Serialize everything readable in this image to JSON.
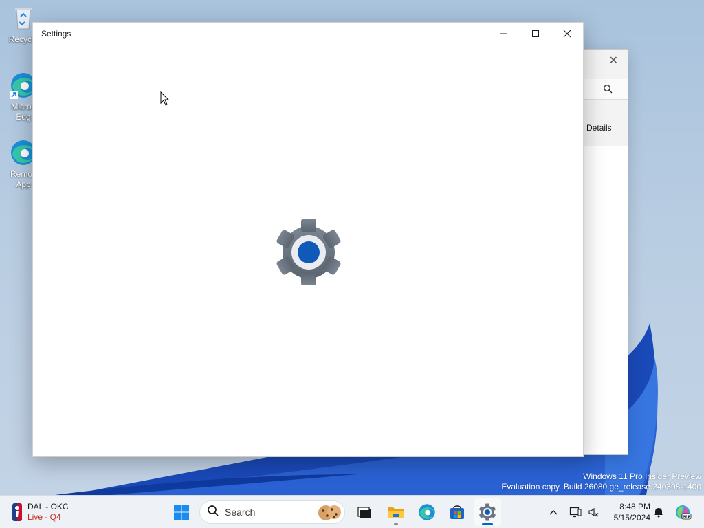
{
  "desktop": {
    "icons": [
      {
        "label": "Recycle",
        "icon": "recycle-bin-icon"
      },
      {
        "label": "Micros\nEdg",
        "icon": "edge-icon"
      },
      {
        "label": "Remov\nApp",
        "icon": "edge-icon"
      }
    ],
    "watermark": {
      "line1": "Windows 11 Pro Insider Preview",
      "line2": "Evaluation copy. Build 26080.ge_release.240308-1400"
    }
  },
  "background_window": {
    "details_label": "Details",
    "icons": [
      "close-icon",
      "search-icon"
    ]
  },
  "settings_window": {
    "title": "Settings",
    "controls": [
      "minimize-icon",
      "maximize-icon",
      "close-icon"
    ],
    "splash_icon": "gear-icon"
  },
  "taskbar": {
    "widget": {
      "line1": "DAL - OKC",
      "line2": "Live - Q4",
      "icon": "nba-logo-icon"
    },
    "search_placeholder": "Search",
    "apps": [
      {
        "name": "start",
        "icon": "windows-logo-icon"
      },
      {
        "name": "task-view",
        "icon": "task-view-icon"
      },
      {
        "name": "file-explorer",
        "icon": "folder-icon",
        "running": true
      },
      {
        "name": "edge",
        "icon": "edge-icon"
      },
      {
        "name": "store",
        "icon": "store-icon"
      },
      {
        "name": "settings",
        "icon": "gear-icon",
        "active": true
      }
    ],
    "tray": {
      "time": "8:48 PM",
      "date": "5/15/2024",
      "icons": [
        "chevron-up-icon",
        "network-icon",
        "volume-icon",
        "notification-icon",
        "copilot-icon"
      ]
    }
  },
  "colors": {
    "accent": "#0067c0",
    "widget_live": "#c42b1c",
    "taskbar_bg": "#eef1f5",
    "desktop_bg": "#b9cde2"
  }
}
